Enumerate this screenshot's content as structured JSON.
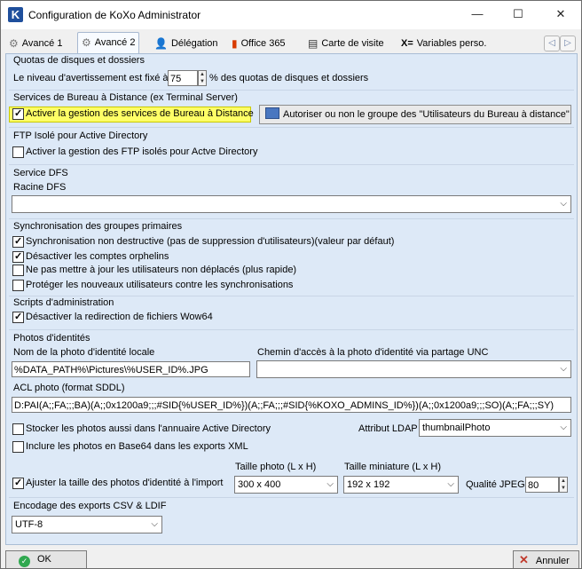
{
  "window": {
    "title": "Configuration de KoXo Administrator",
    "minimize": "—",
    "maximize": "☐",
    "close": "✕"
  },
  "tabs": [
    {
      "label": "Avancé 1",
      "icon": "⚙"
    },
    {
      "label": "Avancé 2",
      "icon": "⚙"
    },
    {
      "label": "Délégation",
      "icon": "👤"
    },
    {
      "label": "Office 365",
      "icon": "▮"
    },
    {
      "label": "Carte de visite",
      "icon": "▤"
    },
    {
      "label": "Variables perso.",
      "icon": "X="
    }
  ],
  "nav": {
    "prev": "◁",
    "next": "▷"
  },
  "quotas": {
    "title": "Quotas de disques et dossiers",
    "before": "Le niveau d'avertissement est fixé à",
    "value": "75",
    "after": "% des quotas de disques et dossiers"
  },
  "rds": {
    "title": "Services de Bureau à Distance (ex Terminal Server)",
    "checkbox": "Activer la gestion des services de Bureau à Distance",
    "button": "Autoriser ou non le groupe des \"Utilisateurs du Bureau à distance\""
  },
  "ftp": {
    "title": "FTP Isolé pour Active Directory",
    "checkbox": "Activer la gestion des FTP isolés pour Actve Directory"
  },
  "dfs": {
    "title": "Service DFS",
    "root_label": "Racine DFS",
    "root_value": ""
  },
  "sync": {
    "title": "Synchronisation des groupes primaires",
    "items": [
      {
        "label": "Synchronisation non destructive (pas de suppression d'utilisateurs)(valeur par défaut)",
        "checked": true
      },
      {
        "label": "Désactiver les comptes orphelins",
        "checked": true
      },
      {
        "label": "Ne pas mettre à jour les utilisateurs non déplacés (plus rapide)",
        "checked": false
      },
      {
        "label": "Protéger les nouveaux utilisateurs contre les synchronisations",
        "checked": false
      }
    ]
  },
  "scripts": {
    "title": "Scripts d'administration",
    "checkbox": "Désactiver la redirection de fichiers Wow64"
  },
  "photos": {
    "title": "Photos d'identités",
    "local_label": "Nom de la photo d'identité locale",
    "local_value": "%DATA_PATH%\\Pictures\\%USER_ID%.JPG",
    "unc_label": "Chemin d'accès à la photo d'identité via partage UNC",
    "unc_value": "",
    "acl_label": "ACL photo (format SDDL)",
    "acl_value": "D:PAI(A;;FA;;;BA)(A;;0x1200a9;;;#SID{%USER_ID%})(A;;FA;;;#SID{%KOXO_ADMINS_ID%})(A;;0x1200a9;;;SO)(A;;FA;;;SY)",
    "store_ad": "Stocker les photos aussi dans l'annuaire Active Directory",
    "ldap_label": "Attribut LDAP",
    "ldap_value": "thumbnailPhoto",
    "base64": "Inclure les photos en Base64 dans les exports XML",
    "resize": "Ajuster la taille des photos d'identité à l'import",
    "size_label": "Taille photo (L x H)",
    "size_value": "300 x 400",
    "thumb_label": "Taille miniature (L x H)",
    "thumb_value": "192 x 192",
    "jpeg_label": "Qualité JPEG",
    "jpeg_value": "80"
  },
  "encoding": {
    "title": "Encodage des exports CSV & LDIF",
    "value": "UTF-8"
  },
  "footer": {
    "ok": "OK",
    "cancel": "Annuler"
  }
}
